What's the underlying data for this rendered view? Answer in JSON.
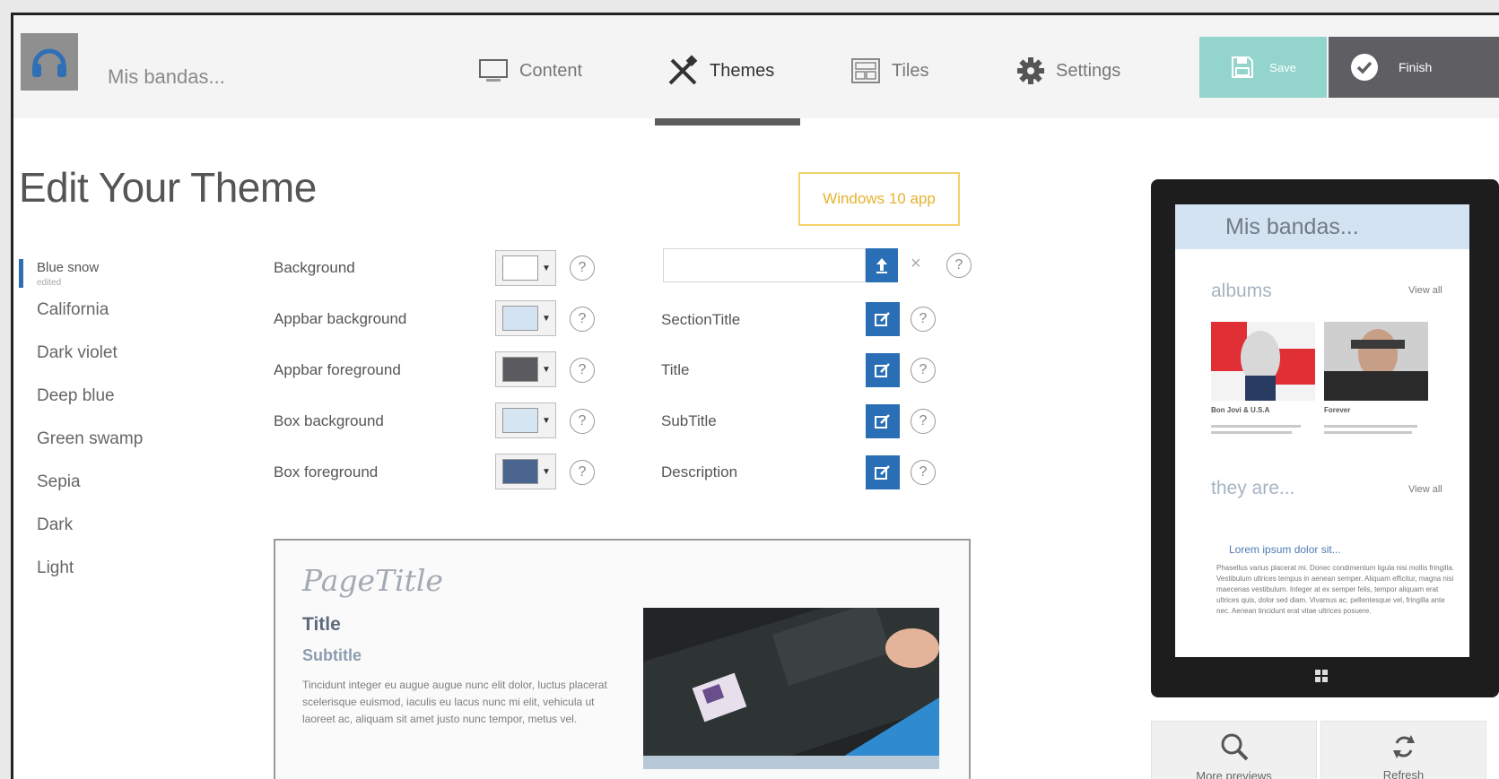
{
  "app": {
    "name": "Mis bandas..."
  },
  "nav": {
    "items": [
      {
        "label": "Content",
        "icon": "monitor-icon"
      },
      {
        "label": "Themes",
        "icon": "tools-icon"
      },
      {
        "label": "Tiles",
        "icon": "tiles-icon"
      },
      {
        "label": "Settings",
        "icon": "gear-icon"
      }
    ],
    "active": "Themes"
  },
  "toolbar": {
    "save_label": "Save",
    "finish_label": "Finish"
  },
  "page": {
    "heading": "Edit Your Theme",
    "badge": "Windows 10 app"
  },
  "themes": {
    "items": [
      "Blue snow",
      "California",
      "Dark violet",
      "Deep blue",
      "Green swamp",
      "Sepia",
      "Dark",
      "Light"
    ],
    "active_sub": "edited",
    "selected": "Blue snow"
  },
  "colors": {
    "background_label": "Background",
    "appbar_background_label": "Appbar background",
    "appbar_foreground_label": "Appbar foreground",
    "box_background_label": "Box background",
    "box_foreground_label": "Box foreground",
    "swatches": {
      "background": "#ffffff",
      "appbar_background": "#d4e3f1",
      "appbar_foreground": "#5b5a5f",
      "box_background": "#d6e5f2",
      "box_foreground": "#4a668f"
    }
  },
  "text_styles": {
    "section_title_label": "SectionTitle",
    "title_label": "Title",
    "subtitle_label": "SubTitle",
    "description_label": "Description"
  },
  "help_symbol": "?",
  "clear_symbol": "×",
  "preview": {
    "page_title": "PageTitle",
    "title": "Title",
    "subtitle": "Subtitle",
    "description": "Tincidunt integer eu augue augue nunc elit dolor, luctus placerat scelerisque euismod, iaculis eu lacus nunc mi elit, vehicula ut laoreet ac, aliquam sit amet justo nunc tempor, metus vel."
  },
  "tablet": {
    "app_title": "Mis bandas...",
    "section1": "albums",
    "section2": "they are...",
    "view_all": "View all",
    "album1_name": "Bon Jovi & U.S.A",
    "album2_name": "Forever",
    "link": "Lorem ipsum dolor sit...",
    "body": "Phasellus varius placerat mi. Donec condimentum ligula nisi mollis fringilla. Vestibulum ultrices tempus in aenean semper. Aliquam efficitur, magna nisi maecenas vestibulum. Integer at ex semper felis, tempor aliquam erat ultrices quis, dolor sed diam. Vivamus ac, pellentesque vel, fringilla ante nec. Aenean tincidunt erat vitae ultrices posuere."
  },
  "bottom": {
    "more_previews": "More previews",
    "refresh": "Refresh"
  }
}
